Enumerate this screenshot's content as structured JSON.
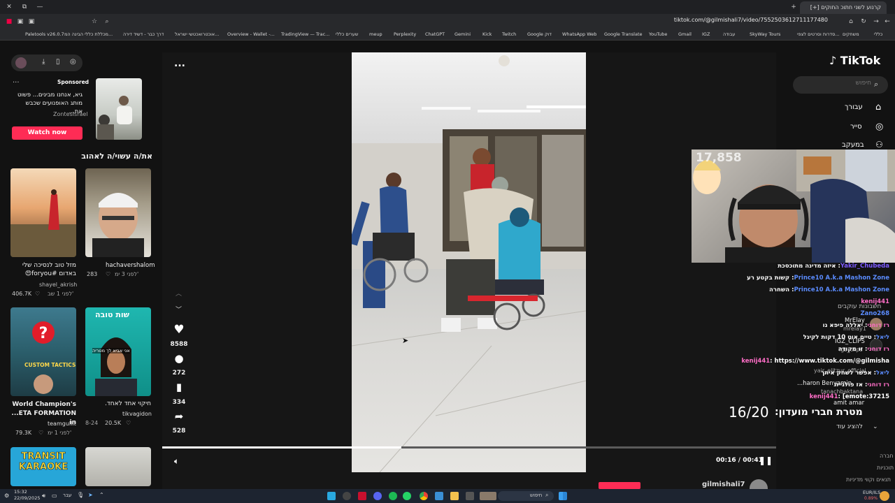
{
  "browser": {
    "tabs": [
      "קרנוע לשני חתוכ החוקים [+]"
    ],
    "url": "tiktok.com/@gilmishali7/video/7552503612711177480",
    "bookmarks": [
      "Paletools v26.0.7",
      "מכללת כללי הבינה המ...",
      "דרך כבר - דשיד דירה",
      "אוכטרואכטשי ישראל...",
      "Overview - Wallet -...",
      "TradingView — Trac...",
      "שערים כללי",
      "meup",
      "Perplexity",
      "ChatGPT",
      "Gemini",
      "Kick",
      "Twitch",
      "Google דוק",
      "WhatsApp Web",
      "Google Translate",
      "YouTube",
      "Gmail",
      "IGZ",
      "עבודה",
      "SkyWay Tours",
      "סדרות וסרטים לצפי...",
      "משחקים",
      "כללי"
    ]
  },
  "sponsored": {
    "label": "Sponsored",
    "title": "גיא, אנחנו מבינים... פשוט מותג האופנועים שכבש את...",
    "advertiser": "ZontesIsrael",
    "cta": "Watch now",
    "more": "..."
  },
  "recommended": {
    "heading": "את/ה עשוי/ה לאהוב",
    "items": [
      {
        "title": "מזל טוב לנסיכה שלי באדום #foryou😍",
        "author": "shayel_akrish",
        "likes": "406.7K",
        "age": "לפני 1 שב'"
      },
      {
        "title": "",
        "author": "hachavershalom",
        "likes": "283",
        "age": "לפני 3 ימ'"
      },
      {
        "title": "World Champion's ...ETA FORMATION in",
        "author": "teamgullit",
        "likes": "79.3K",
        "age": "לפני 1 ימ'"
      },
      {
        "title": "חיקוי אחד לאחד.",
        "author": "tikvagidon",
        "likes": "20.5K",
        "age": "8-24"
      },
      {
        "title": "TRANSIT KARAOKE",
        "author": "",
        "likes": "",
        "age": ""
      },
      {
        "title": "",
        "author": "",
        "likes": "",
        "age": ""
      }
    ],
    "thumb_texts": {
      "custom_tactics": "CUSTOM TACTICS",
      "sticker_top": "שות טובה",
      "sticker_sub": "אני אביא לך מטריה"
    }
  },
  "player": {
    "more": "...",
    "likes": "8588",
    "comments": "272",
    "saves": "334",
    "shares": "528",
    "time": "00:16 / 00:41",
    "progress": 0.39,
    "author": "gilmishali7"
  },
  "tiktok": {
    "logo": "TikTok",
    "search_placeholder": "חיפוש",
    "nav": [
      "עבורך",
      "סייר",
      "במעקב"
    ],
    "following_heading": "חשבונות עוקבים",
    "following": [
      {
        "name": "MrElay",
        "handle": "mrelay1"
      },
      {
        "name": "IGZ_CLIPS",
        "handle": "igz_clips"
      },
      {
        "name": "",
        "handle": "yair_elitzur_official"
      },
      {
        "name": "...haron Benyamin",
        "handle": "tanachbaktana"
      },
      {
        "name": "amit amar",
        "handle": "..."
      }
    ],
    "see_more": "להציג עוד",
    "footer": [
      "חברה",
      "תוכניות",
      "תנאים וקווי מדיניות"
    ]
  },
  "stream": {
    "counter": "16/20",
    "goal_text": "מטרת חברי מועדון:",
    "sticker_text": "17,858",
    "chat": [
      {
        "user": "Yakir_Chubeda",
        "msg": "איזה מדינה מתוכסכת",
        "color": "#7d5cff"
      },
      {
        "user": "Prince10 A.k.a Mashon Zone",
        "msg": "קשות בקטע רע",
        "color": "#5b8cff"
      },
      {
        "user": "Prince10 A.k.a Mashon Zone",
        "msg": "השחרה",
        "color": "#5b8cff"
      },
      {
        "user": "kenij441",
        "msg": "",
        "color": "#ff6ec7"
      },
      {
        "user": "Zano268",
        "msg": "",
        "color": "#5b8cff"
      },
      {
        "user": "רז דוחני",
        "msg": "יאללה פיפא נו",
        "color": "#ff6ec7"
      },
      {
        "user": "ליאל",
        "msg": "טיים אוט 10 דקות לקיגל",
        "color": "#5b8cff"
      },
      {
        "user": "רז דוחני",
        "msg": "זו מקודה",
        "color": "#ff6ec7"
      },
      {
        "user": "kenij441",
        "msg": "https://www.tiktok.com/@gilmisha",
        "color": "#ff6ec7"
      },
      {
        "user": "ליאל",
        "msg": "אפשר לשחק איתך",
        "color": "#5b8cff"
      },
      {
        "user": "רז דוחני",
        "msg": "אז פולגייה",
        "color": "#ff6ec7"
      },
      {
        "user": "kenij441",
        "msg": "[emote:37215",
        "color": "#ff6ec7"
      }
    ]
  },
  "taskbar": {
    "time": "15:32",
    "date": "22/09/2025",
    "lang": "עבר",
    "search": "חיפוש",
    "ticker": "EUR/ILS",
    "ticker_change": "0.89%"
  },
  "colors": {
    "accent": "#fe2c55",
    "bg": "#121212"
  }
}
